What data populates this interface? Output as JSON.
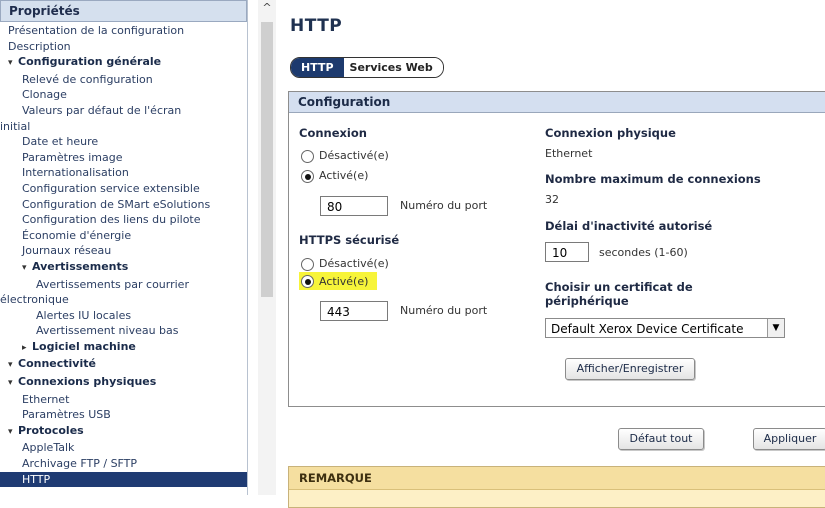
{
  "sidebar": {
    "header": "Propriétés",
    "items": [
      {
        "label": "Présentation de la configuration"
      },
      {
        "label": "Description"
      },
      {
        "label": "Configuration générale"
      },
      {
        "label": "Relevé de configuration"
      },
      {
        "label": "Clonage"
      },
      {
        "label": "Valeurs par défaut de l'écran"
      },
      {
        "label": "initial"
      },
      {
        "label": "Date et heure"
      },
      {
        "label": "Paramètres image"
      },
      {
        "label": "Internationalisation"
      },
      {
        "label": "Configuration service extensible"
      },
      {
        "label": "Configuration de SMart eSolutions"
      },
      {
        "label": "Configuration des liens du pilote"
      },
      {
        "label": "Économie d'énergie"
      },
      {
        "label": "Journaux réseau"
      },
      {
        "label": "Avertissements"
      },
      {
        "label": "Avertissements par courrier"
      },
      {
        "label": "électronique"
      },
      {
        "label": "Alertes IU locales"
      },
      {
        "label": "Avertissement niveau bas"
      },
      {
        "label": "Logiciel machine"
      },
      {
        "label": "Connectivité"
      },
      {
        "label": "Connexions physiques"
      },
      {
        "label": "Ethernet"
      },
      {
        "label": "Paramètres USB"
      },
      {
        "label": "Protocoles"
      },
      {
        "label": "AppleTalk"
      },
      {
        "label": "Archivage FTP / SFTP"
      },
      {
        "label": "HTTP"
      }
    ]
  },
  "scroll": {
    "up_glyph": "^"
  },
  "main": {
    "title": "HTTP",
    "tabs": [
      {
        "label": "HTTP"
      },
      {
        "label": "Services Web"
      }
    ],
    "panel": {
      "title": "Configuration",
      "connexion": {
        "title": "Connexion",
        "options": [
          "Désactivé(e)",
          "Activé(e)"
        ],
        "selected": "Activé(e)",
        "port_value": "80",
        "port_label": "Numéro du port"
      },
      "https": {
        "title": "HTTPS sécurisé",
        "options": [
          "Désactivé(e)",
          "Activé(e)"
        ],
        "selected": "Activé(e)",
        "port_value": "443",
        "port_label": "Numéro du port"
      },
      "physical": {
        "title": "Connexion physique",
        "value": "Ethernet"
      },
      "max_connections": {
        "title": "Nombre maximum de connexions",
        "value": "32"
      },
      "timeout": {
        "title": "Délai d'inactivité autorisé",
        "value": "10",
        "unit": "secondes (1-60)"
      },
      "certificate": {
        "title_line1": "Choisir un certificat de",
        "title_line2": "périphérique",
        "selected": "Default Xerox Device Certificate",
        "view_button": "Afficher/Enregistrer"
      }
    },
    "buttons": {
      "reset": "Défaut tout",
      "apply": "Appliquer"
    },
    "note": {
      "title": "REMARQUE"
    },
    "highlight_color": "#f7f43a",
    "accent_color": "#1d3a6e"
  }
}
